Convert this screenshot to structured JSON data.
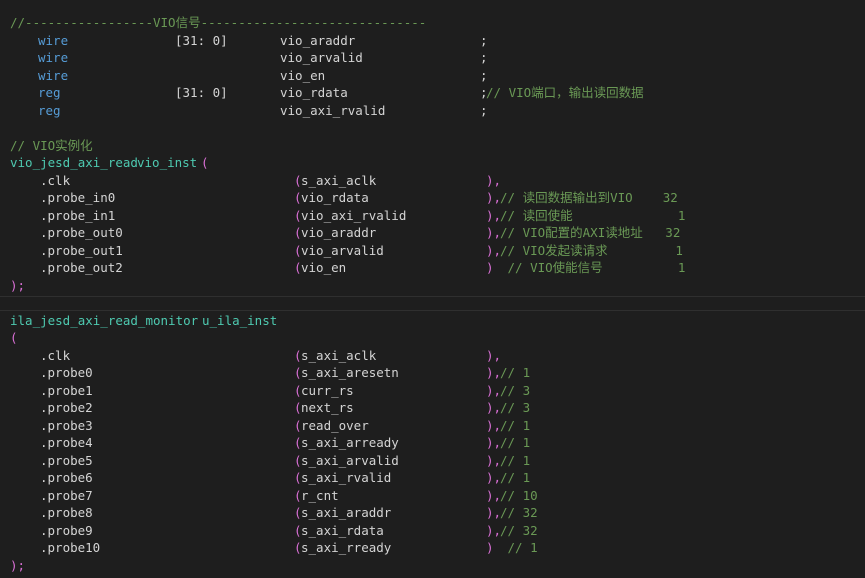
{
  "colors": {
    "background": "#1e1e1e",
    "comment": "#6a9955",
    "keyword": "#569cd6",
    "text": "#d4d4d4",
    "number": "#b5cea8",
    "module_name": "#4ec9b0",
    "paren": "#da70d6",
    "bracket": "#ffd700"
  },
  "code": {
    "header_comment": "//-----------------VIO信号------------------------------",
    "wires": [
      {
        "kw": "wire",
        "range": "[31: 0]",
        "name": "vio_araddr",
        "end": ";",
        "comment": ""
      },
      {
        "kw": "wire",
        "range": "",
        "name": "vio_arvalid",
        "end": ";",
        "comment": ""
      },
      {
        "kw": "wire",
        "range": "",
        "name": "vio_en",
        "end": ";",
        "comment": ""
      },
      {
        "kw": "reg",
        "range": "[31: 0]",
        "name": "vio_rdata",
        "end": ";",
        "comment": "// VIO端口，输出读回数据"
      },
      {
        "kw": "reg",
        "range": "",
        "name": "vio_axi_rvalid",
        "end": ";",
        "comment": ""
      }
    ],
    "vio_comment": "// VIO实例化",
    "vio_module": "vio_jesd_axi_read",
    "vio_instance": "vio_inst",
    "vio_open": "(",
    "vio_ports": [
      {
        "port": ".clk",
        "signal": "s_axi_aclk",
        "end": "),",
        "comment": ""
      },
      {
        "port": ".probe_in0",
        "signal": "vio_rdata",
        "end": "),",
        "comment": "// 读回数据输出到VIO    32"
      },
      {
        "port": ".probe_in1",
        "signal": "vio_axi_rvalid",
        "end": "),",
        "comment": "// 读回使能              1"
      },
      {
        "port": ".probe_out0",
        "signal": "vio_araddr",
        "end": "),",
        "comment": "// VIO配置的AXI读地址   32"
      },
      {
        "port": ".probe_out1",
        "signal": "vio_arvalid",
        "end": "),",
        "comment": "// VIO发起读请求         1"
      },
      {
        "port": ".probe_out2",
        "signal": "vio_en",
        "end": ")",
        "comment": " // VIO使能信号          1"
      }
    ],
    "vio_close": ");",
    "ila_module": "ila_jesd_axi_read_monitor",
    "ila_instance": "u_ila_inst",
    "ila_open": "(",
    "ila_ports": [
      {
        "port": ".clk",
        "signal": "s_axi_aclk",
        "end": "),",
        "comment": ""
      },
      {
        "port": ".probe0",
        "signal": "s_axi_aresetn",
        "end": "),",
        "comment": "// 1"
      },
      {
        "port": ".probe1",
        "signal": "curr_rs",
        "end": "),",
        "comment": "// 3"
      },
      {
        "port": ".probe2",
        "signal": "next_rs",
        "end": "),",
        "comment": "// 3"
      },
      {
        "port": ".probe3",
        "signal": "read_over",
        "end": "),",
        "comment": "// 1"
      },
      {
        "port": ".probe4",
        "signal": "s_axi_arready",
        "end": "),",
        "comment": "// 1"
      },
      {
        "port": ".probe5",
        "signal": "s_axi_arvalid",
        "end": "),",
        "comment": "// 1"
      },
      {
        "port": ".probe6",
        "signal": "s_axi_rvalid",
        "end": "),",
        "comment": "// 1"
      },
      {
        "port": ".probe7",
        "signal": "r_cnt",
        "end": "),",
        "comment": "// 10"
      },
      {
        "port": ".probe8",
        "signal": "s_axi_araddr",
        "end": "),",
        "comment": "// 32"
      },
      {
        "port": ".probe9",
        "signal": "s_axi_rdata",
        "end": "),",
        "comment": "// 32"
      },
      {
        "port": ".probe10",
        "signal": "s_axi_rready",
        "end": ")",
        "comment": " // 1"
      }
    ],
    "ila_close": ");"
  }
}
